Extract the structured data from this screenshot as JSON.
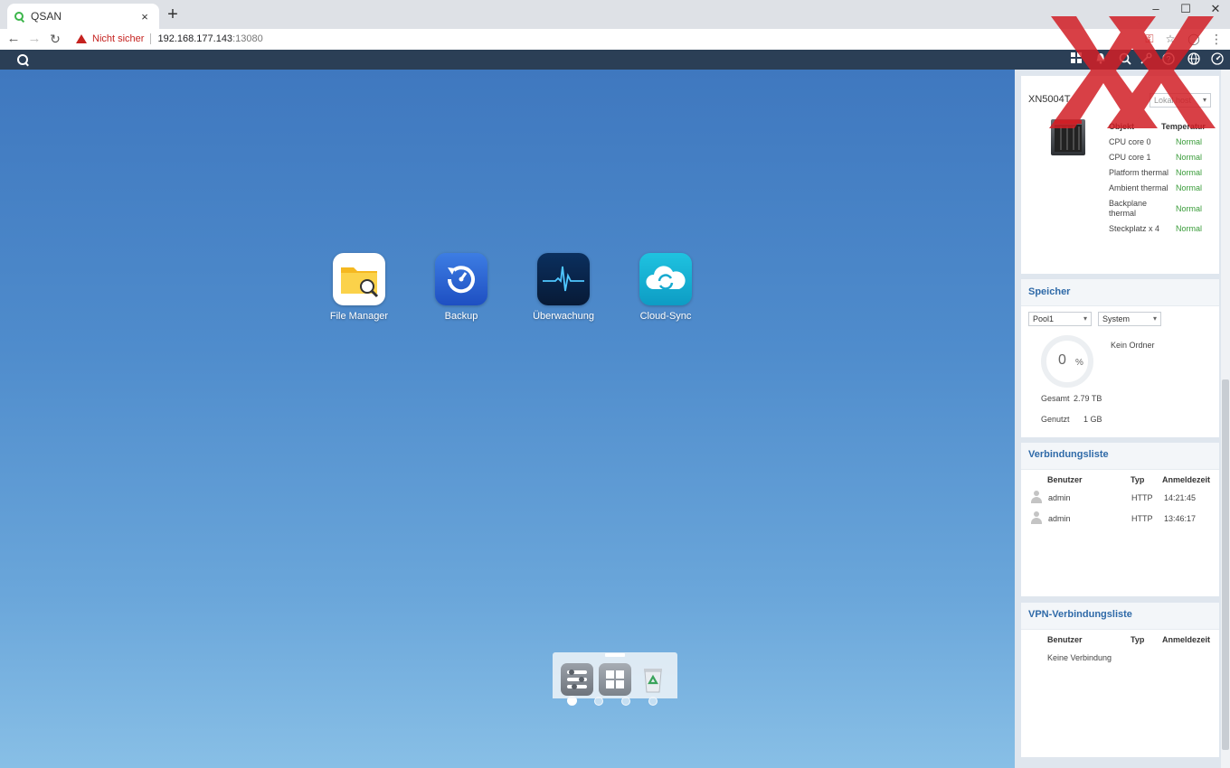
{
  "browser": {
    "tab_title": "QSAN",
    "tab_close": "×",
    "new_tab": "+",
    "security_warning": "Nicht sicher",
    "url_host": "192.168.177.143",
    "url_port": ":13080",
    "window_controls": [
      "–",
      "☐",
      "✕"
    ]
  },
  "desktop": {
    "apps": [
      {
        "label": "File Manager",
        "icon": "file-manager-icon"
      },
      {
        "label": "Backup",
        "icon": "backup-icon"
      },
      {
        "label": "Überwachung",
        "icon": "monitor-icon"
      },
      {
        "label": "Cloud-Sync",
        "icon": "cloud-sync-icon"
      }
    ],
    "pages": 4,
    "active_page": 1,
    "dock": [
      "control-panel-icon",
      "app-center-icon",
      "recycle-bin-icon"
    ]
  },
  "system_card": {
    "device_name": "XN5004T",
    "location_select": "Lokal host",
    "col_object": "Objekt",
    "col_temperature": "Temperatur",
    "rows": [
      {
        "object": "CPU core 0",
        "status": "Normal"
      },
      {
        "object": "CPU core 1",
        "status": "Normal"
      },
      {
        "object": "Platform thermal",
        "status": "Normal"
      },
      {
        "object": "Ambient thermal",
        "status": "Normal"
      },
      {
        "object": "Backplane thermal",
        "status": "Normal"
      },
      {
        "object": "Steckplatz x 4",
        "status": "Normal"
      }
    ]
  },
  "storage_card": {
    "title": "Speicher",
    "pool_select": "Pool1",
    "volume_select": "System",
    "usage_value": "0",
    "usage_unit": "%",
    "usage_percent": 0,
    "folder_text": "Kein Ordner",
    "total_label": "Gesamt",
    "total_value": "2.79 TB",
    "used_label": "Genutzt",
    "used_value": "1 GB"
  },
  "connections_card": {
    "title": "Verbindungsliste",
    "col_user": "Benutzer",
    "col_type": "Typ",
    "col_time": "Anmeldezeit",
    "rows": [
      {
        "user": "admin",
        "type": "HTTP",
        "time": "14:21:45"
      },
      {
        "user": "admin",
        "type": "HTTP",
        "time": "13:46:17"
      }
    ]
  },
  "vpn_card": {
    "title": "VPN-Verbindungsliste",
    "col_user": "Benutzer",
    "col_type": "Typ",
    "col_time": "Anmeldezeit",
    "empty_text": "Keine Verbindung"
  },
  "colors": {
    "app_bar": "#2b3f56",
    "accent": "#2f6aa8",
    "status_ok": "#3a9c3a",
    "warning": "#c5221f"
  }
}
